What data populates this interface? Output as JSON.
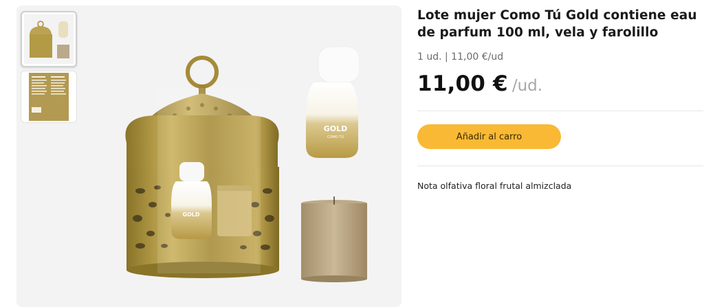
{
  "product": {
    "title": "Lote mujer Como Tú Gold contiene eau de parfum 100 ml, vela y farolillo",
    "unit_info": "1 ud. | 11,00 €/ud",
    "price": "11,00 €",
    "price_unit": "/ud.",
    "add_to_cart_label": "Añadir al carro",
    "description": "Nota olfativa floral frutal almizclada"
  },
  "gallery": {
    "thumbnails": [
      {
        "icon": "product-set-thumbnail",
        "active": true
      },
      {
        "icon": "product-back-label-thumbnail",
        "active": false
      }
    ],
    "bottle_text": "GOLD",
    "bottle_subtext": "COMO TÚ"
  },
  "colors": {
    "accent": "#f9b934",
    "gold": "#b49a3e",
    "image_bg": "#f3f3f3"
  }
}
